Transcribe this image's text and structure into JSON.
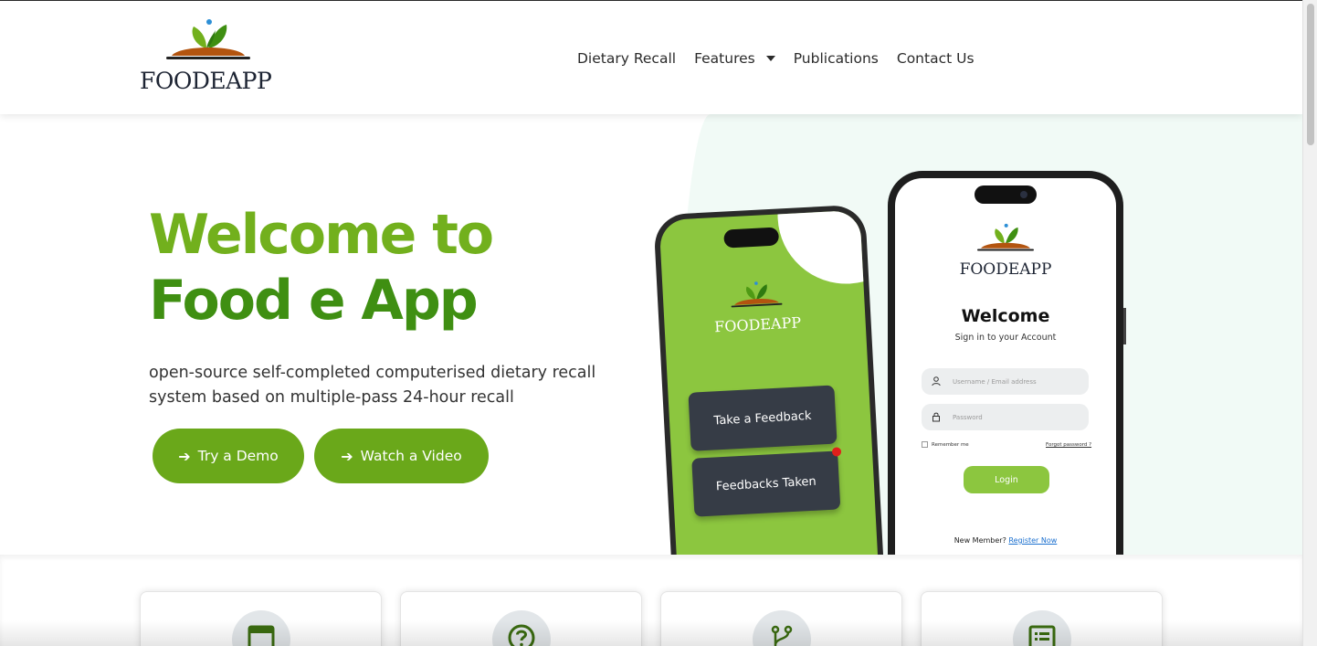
{
  "brand": {
    "logo_text": "FOODEAPP",
    "primary_green": "#72b01d",
    "dark_green": "#3f8f12",
    "button_green": "#6aa81a",
    "soil_brown": "#b3540f"
  },
  "nav": {
    "items": [
      {
        "label": "Dietary Recall"
      },
      {
        "label": "Features",
        "has_dropdown": true,
        "icon": "caret-down-icon"
      },
      {
        "label": "Publications"
      },
      {
        "label": "Contact Us"
      }
    ]
  },
  "hero": {
    "title_line1": "Welcome to",
    "title_line2": "Food e App",
    "subtitle": "open-source self-completed computerised dietary recall system based on multiple-pass 24-hour recall",
    "buttons": [
      {
        "label": "Try a Demo",
        "icon": "arrow-right-icon"
      },
      {
        "label": "Watch a Video",
        "icon": "arrow-right-icon"
      }
    ]
  },
  "phone_left": {
    "logo_text": "FOODEAPP",
    "button1": "Take a Feedback",
    "button2": "Feedbacks Taken"
  },
  "phone_right": {
    "logo_text": "FOODEAPP",
    "welcome": "Welcome",
    "signin": "Sign in to your Account",
    "username_placeholder": "Username / Email address",
    "password_placeholder": "Password",
    "remember": "Remember me",
    "forgot": "Forgot password ?",
    "login": "Login",
    "new_member": "New Member?",
    "register": "Register Now"
  },
  "feature_cards": [
    {
      "icon": "calendar-icon"
    },
    {
      "icon": "question-icon"
    },
    {
      "icon": "branch-icon"
    },
    {
      "icon": "list-icon"
    }
  ]
}
